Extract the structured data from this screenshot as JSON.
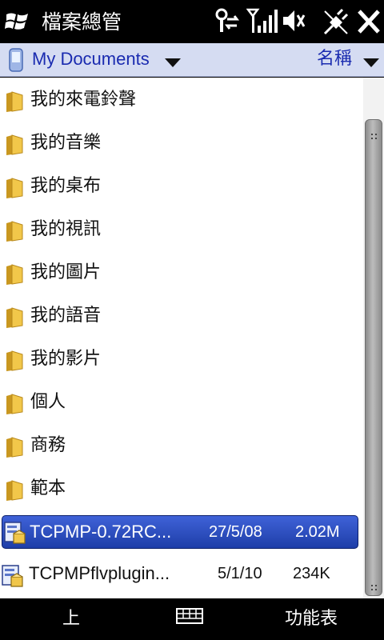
{
  "titlebar": {
    "app_title": "檔案總管",
    "icons": [
      "windows-start-icon",
      "connectivity-icon",
      "signal-icon",
      "volume-muted-icon",
      "usb-sync-icon",
      "close-icon"
    ]
  },
  "folderbar": {
    "folder_name": "My Documents",
    "sort_label": "名稱"
  },
  "files": {
    "folders": [
      {
        "name": "我的來電鈴聲"
      },
      {
        "name": "我的音樂"
      },
      {
        "name": "我的桌布"
      },
      {
        "name": "我的視訊"
      },
      {
        "name": "我的圖片"
      },
      {
        "name": "我的語音"
      },
      {
        "name": "我的影片"
      },
      {
        "name": "個人"
      },
      {
        "name": "商務"
      },
      {
        "name": "範本"
      }
    ],
    "items": [
      {
        "name": "TCPMP-0.72RC...",
        "date": "27/5/08",
        "size": "2.02M",
        "selected": true
      },
      {
        "name": "TCPMPflvplugin...",
        "date": "5/1/10",
        "size": "234K",
        "selected": false
      }
    ]
  },
  "softkeys": {
    "left": "上",
    "right": "功能表"
  },
  "colors": {
    "header_bg": "#d5dcf2",
    "header_text": "#1a2bb0",
    "selection": "#2e4fc4"
  }
}
